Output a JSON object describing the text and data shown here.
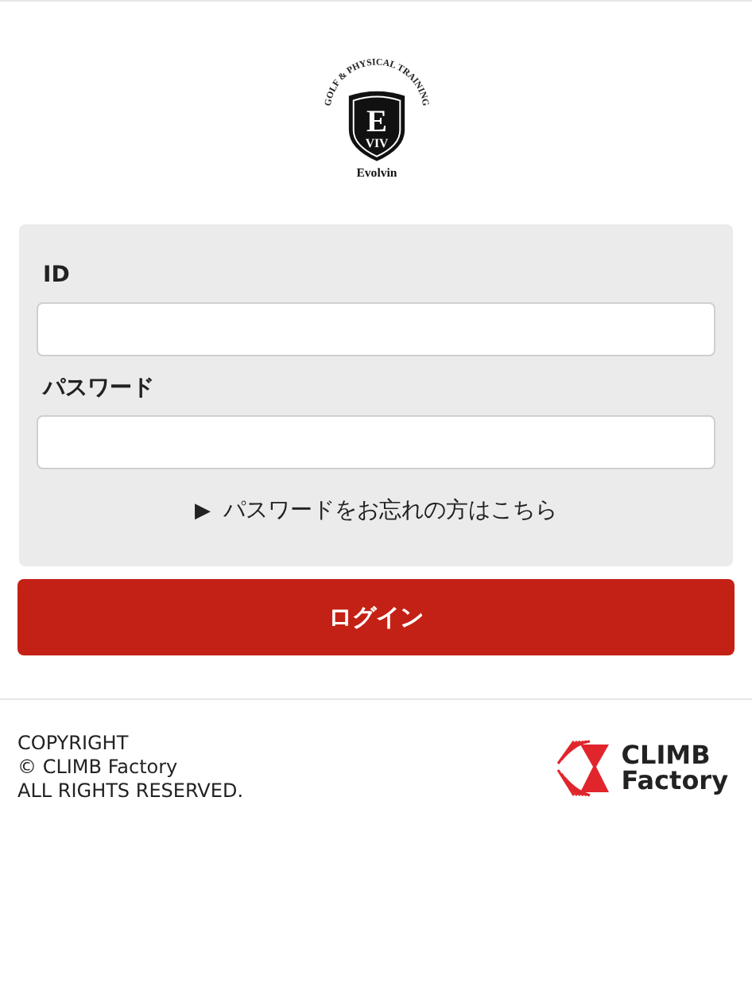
{
  "logo": {
    "arc_text": "GOLF & PHYSICAL TRAINING",
    "initial": "E",
    "sub_initials": "VIV",
    "name": "Evolvin"
  },
  "form": {
    "fields": [
      {
        "label": "ID"
      },
      {
        "label": "パスワード"
      }
    ],
    "forgot_link": {
      "marker": "▶",
      "text": "パスワードをお忘れの方はこちら"
    }
  },
  "login_button": "ログイン",
  "footer": {
    "copyright": [
      "COPYRIGHT",
      "© CLIMB Factory",
      "ALL RIGHTS RESERVED."
    ],
    "brand": [
      "CLIMB",
      "Factory"
    ]
  }
}
